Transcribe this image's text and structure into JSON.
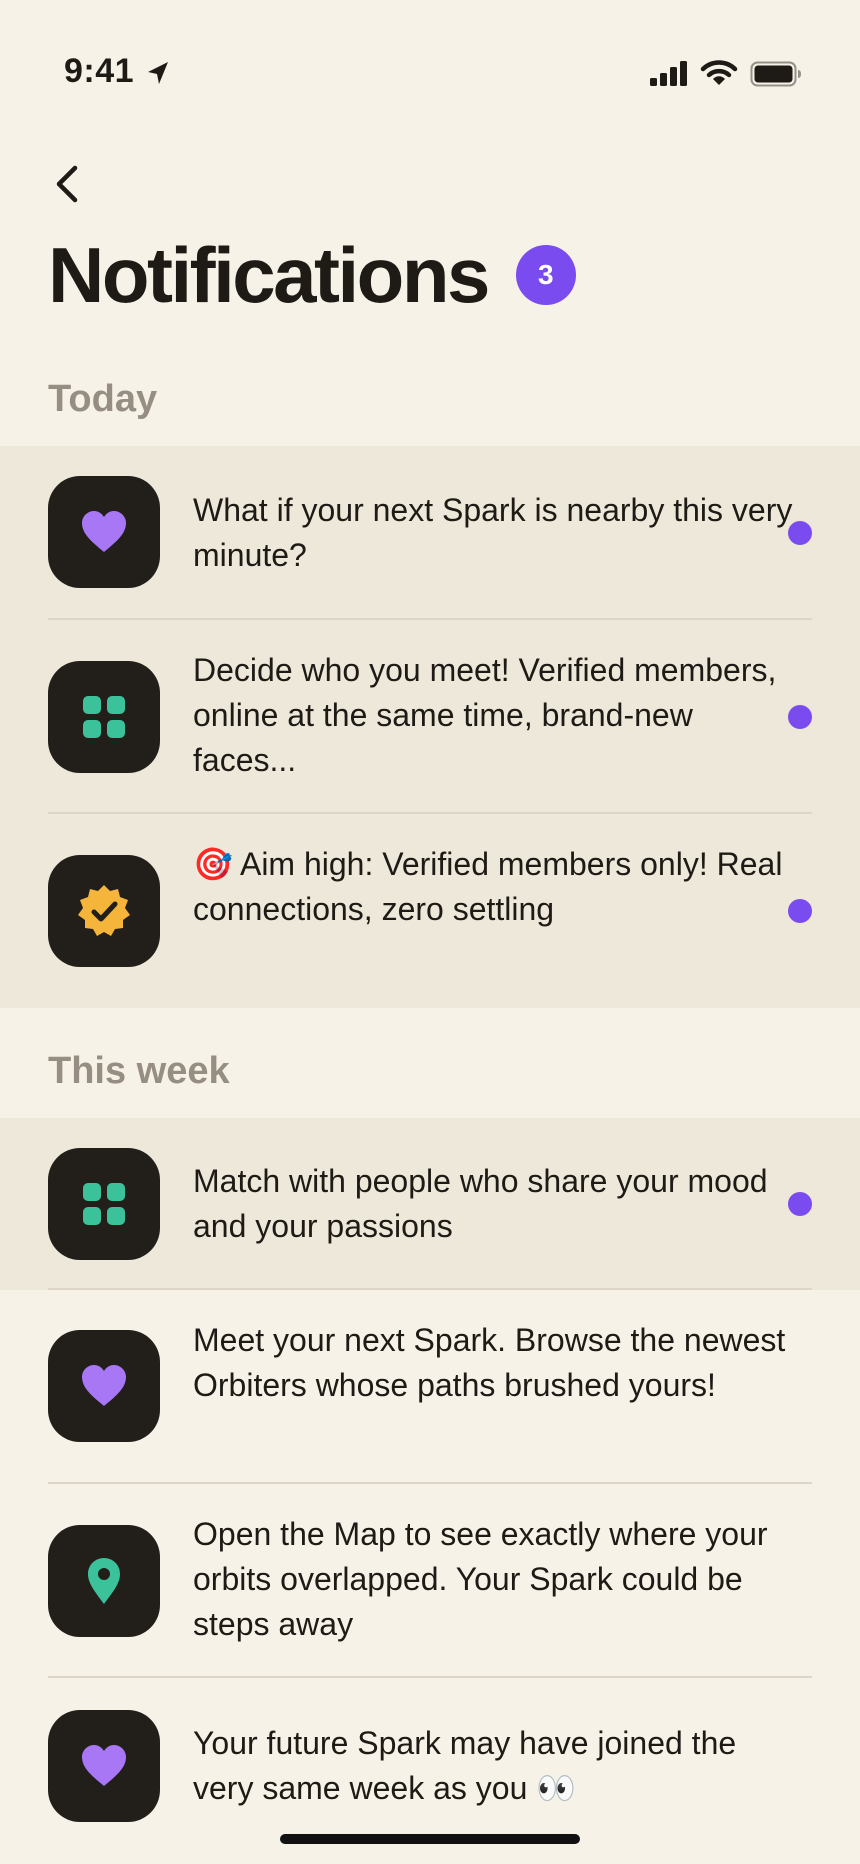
{
  "status_bar": {
    "time": "9:41"
  },
  "header": {
    "title": "Notifications",
    "unread_count": "3"
  },
  "sections": [
    {
      "label": "Today"
    },
    {
      "label": "This week"
    }
  ],
  "notifications": [
    {
      "icon": "heart-icon",
      "text": "What if your next Spark is nearby this very minute?",
      "unread": true
    },
    {
      "icon": "grid-icon",
      "text": "Decide who you meet! Verified members, online at the same time, brand-new faces...",
      "unread": true
    },
    {
      "icon": "verified-badge-icon",
      "text": "🎯  Aim high: Verified members only! Real connections, zero settling",
      "unread": true
    },
    {
      "icon": "grid-icon",
      "text": "Match with people who share your mood and your passions",
      "unread": true
    },
    {
      "icon": "heart-icon",
      "text": "Meet your next Spark. Browse the newest Orbiters whose paths brushed yours!",
      "unread": false
    },
    {
      "icon": "map-pin-icon",
      "text": "Open the Map to see exactly where your orbits overlapped. Your Spark could be steps away",
      "unread": false
    },
    {
      "icon": "heart-icon",
      "text": "Your future Spark may have joined the very same week as you 👀",
      "unread": false
    }
  ],
  "colors": {
    "accent": "#7A4BEF",
    "icon_bg": "#221F1B",
    "teal": "#3CC29A",
    "amber": "#F5B43A",
    "unread_bg": "#EEE8DA",
    "page_bg": "#F6F2E7"
  }
}
